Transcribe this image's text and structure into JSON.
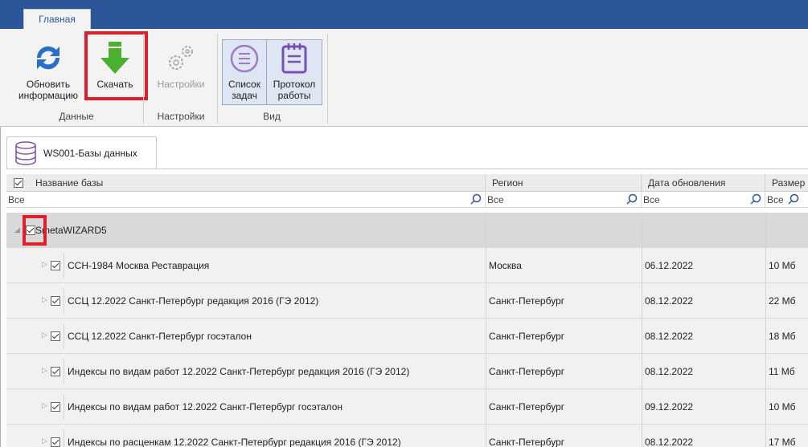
{
  "ribbon": {
    "tab_main": "Главная",
    "btn_refresh": [
      "Обновить",
      "информацию"
    ],
    "btn_download": "Скачать",
    "btn_settings": "Настройки",
    "btn_tasklist": [
      "Список",
      "задач"
    ],
    "btn_protocol": [
      "Протокол",
      "работы"
    ],
    "group_data": "Данные",
    "group_settings": "Настройки",
    "group_view": "Вид"
  },
  "doc_tab": "WS001-Базы данных",
  "grid": {
    "columns": [
      "Название базы",
      "Регион",
      "Дата обновления",
      "Размер"
    ],
    "filters": [
      "Все",
      "Все",
      "Все",
      "Все"
    ],
    "group_name": "SmetaWIZARD5",
    "rows": [
      {
        "name": "ССН-1984 Москва Реставрация",
        "region": "Москва",
        "date": "06.12.2022",
        "size": "10 Мб"
      },
      {
        "name": "ССЦ 12.2022 Санкт-Петербург редакция 2016 (ГЭ 2012)",
        "region": "Санкт-Петербург",
        "date": "08.12.2022",
        "size": "22 Мб"
      },
      {
        "name": "ССЦ 12.2022 Санкт-Петербург госэталон",
        "region": "Санкт-Петербург",
        "date": "08.12.2022",
        "size": "18 Мб"
      },
      {
        "name": "Индексы по видам работ 12.2022 Санкт-Петербург редакция 2016 (ГЭ 2012)",
        "region": "Санкт-Петербург",
        "date": "08.12.2022",
        "size": "11 Мб"
      },
      {
        "name": "Индексы по видам работ 12.2022 Санкт-Петербург госэталон",
        "region": "Санкт-Петербург",
        "date": "09.12.2022",
        "size": "10 Мб"
      },
      {
        "name": "Индексы по расценкам 12.2022 Санкт-Петербург редакция 2016 (ГЭ 2012)",
        "region": "Санкт-Петербург",
        "date": "08.12.2022",
        "size": "17 Мб"
      }
    ]
  },
  "colors": {
    "titlebar": "#2b579a",
    "highlight": "#e01e2b",
    "download_green": "#4caf2f",
    "refresh_blue": "#2a6fc9",
    "view_purple": "#7a4fb3"
  }
}
